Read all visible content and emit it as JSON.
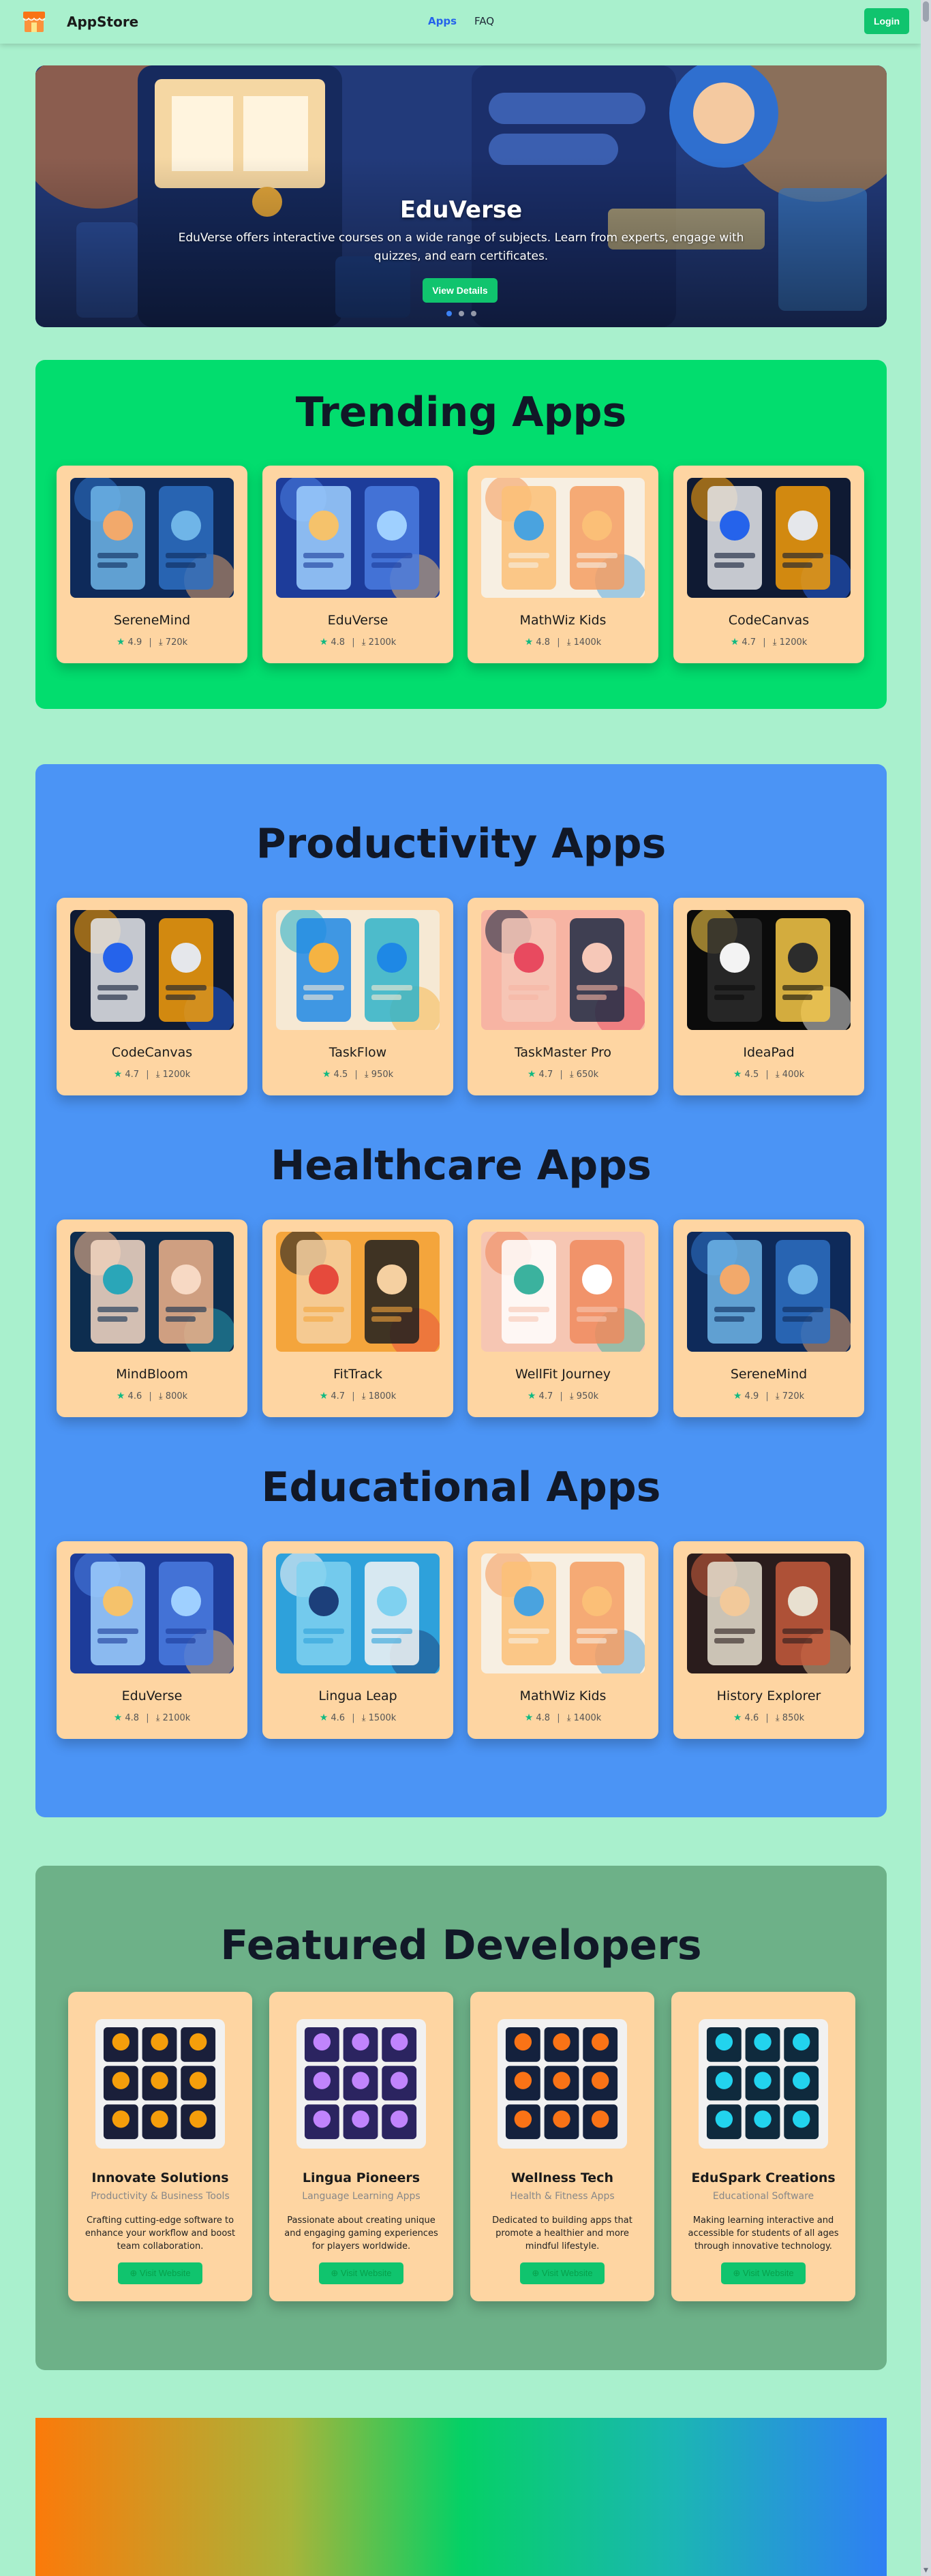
{
  "nav": {
    "brand": "AppStore",
    "links": [
      "Apps",
      "FAQ"
    ],
    "login": "Login"
  },
  "hero": {
    "title": "EduVerse",
    "description": "EduVerse offers interactive courses on a wide range of subjects. Learn from experts, engage with quizzes, and earn certificates.",
    "button": "View Details",
    "slides": 3,
    "active_slide": 0
  },
  "trending": {
    "title": "Trending Apps",
    "apps": [
      {
        "name": "SereneMind",
        "rating": "4.9",
        "downloads": "720k",
        "theme": "meditation"
      },
      {
        "name": "EduVerse",
        "rating": "4.8",
        "downloads": "2100k",
        "theme": "education"
      },
      {
        "name": "MathWiz Kids",
        "rating": "4.8",
        "downloads": "1400k",
        "theme": "kids"
      },
      {
        "name": "CodeCanvas",
        "rating": "4.7",
        "downloads": "1200k",
        "theme": "code"
      }
    ]
  },
  "productivity": {
    "title": "Productivity Apps",
    "apps": [
      {
        "name": "CodeCanvas",
        "rating": "4.7",
        "downloads": "1200k",
        "theme": "code"
      },
      {
        "name": "TaskFlow",
        "rating": "4.5",
        "downloads": "950k",
        "theme": "tasks"
      },
      {
        "name": "TaskMaster Pro",
        "rating": "4.7",
        "downloads": "650k",
        "theme": "pink"
      },
      {
        "name": "IdeaPad",
        "rating": "4.5",
        "downloads": "400k",
        "theme": "idea"
      }
    ]
  },
  "healthcare": {
    "title": "Healthcare Apps",
    "apps": [
      {
        "name": "MindBloom",
        "rating": "4.6",
        "downloads": "800k",
        "theme": "lotus"
      },
      {
        "name": "FitTrack",
        "rating": "4.7",
        "downloads": "1800k",
        "theme": "fitness"
      },
      {
        "name": "WellFit Journey",
        "rating": "4.7",
        "downloads": "950k",
        "theme": "wellness"
      },
      {
        "name": "SereneMind",
        "rating": "4.9",
        "downloads": "720k",
        "theme": "meditation"
      }
    ]
  },
  "educational": {
    "title": "Educational Apps",
    "apps": [
      {
        "name": "EduVerse",
        "rating": "4.8",
        "downloads": "2100k",
        "theme": "education"
      },
      {
        "name": "Lingua Leap",
        "rating": "4.6",
        "downloads": "1500k",
        "theme": "laptop"
      },
      {
        "name": "MathWiz Kids",
        "rating": "4.8",
        "downloads": "1400k",
        "theme": "kids"
      },
      {
        "name": "History Explorer",
        "rating": "4.6",
        "downloads": "850k",
        "theme": "history"
      }
    ]
  },
  "developers": {
    "title": "Featured Developers",
    "button": "Visit Website",
    "items": [
      {
        "name": "Innovate Solutions",
        "category": "Productivity & Business Tools",
        "description": "Crafting cutting-edge software to enhance your workflow and boost team collaboration.",
        "theme": "dark"
      },
      {
        "name": "Lingua Pioneers",
        "category": "Language Learning Apps",
        "description": "Passionate about creating unique and engaging gaming experiences for players worldwide.",
        "theme": "purple"
      },
      {
        "name": "Wellness Tech",
        "category": "Health & Fitness Apps",
        "description": "Dedicated to building apps that promote a healthier and more mindful lifestyle.",
        "theme": "orange"
      },
      {
        "name": "EduSpark Creations",
        "category": "Educational Software",
        "description": "Making learning interactive and accessible for students of all ages through innovative technology.",
        "theme": "teal"
      }
    ]
  },
  "colors": {
    "page_bg": "#a9f0cd",
    "accent": "#10c46e",
    "trending_bg": "#02dd6e",
    "categories_bg": "#4b94f5",
    "developers_bg": "#6db188",
    "card_bg": "#fed5a2",
    "star": "#10b981"
  }
}
